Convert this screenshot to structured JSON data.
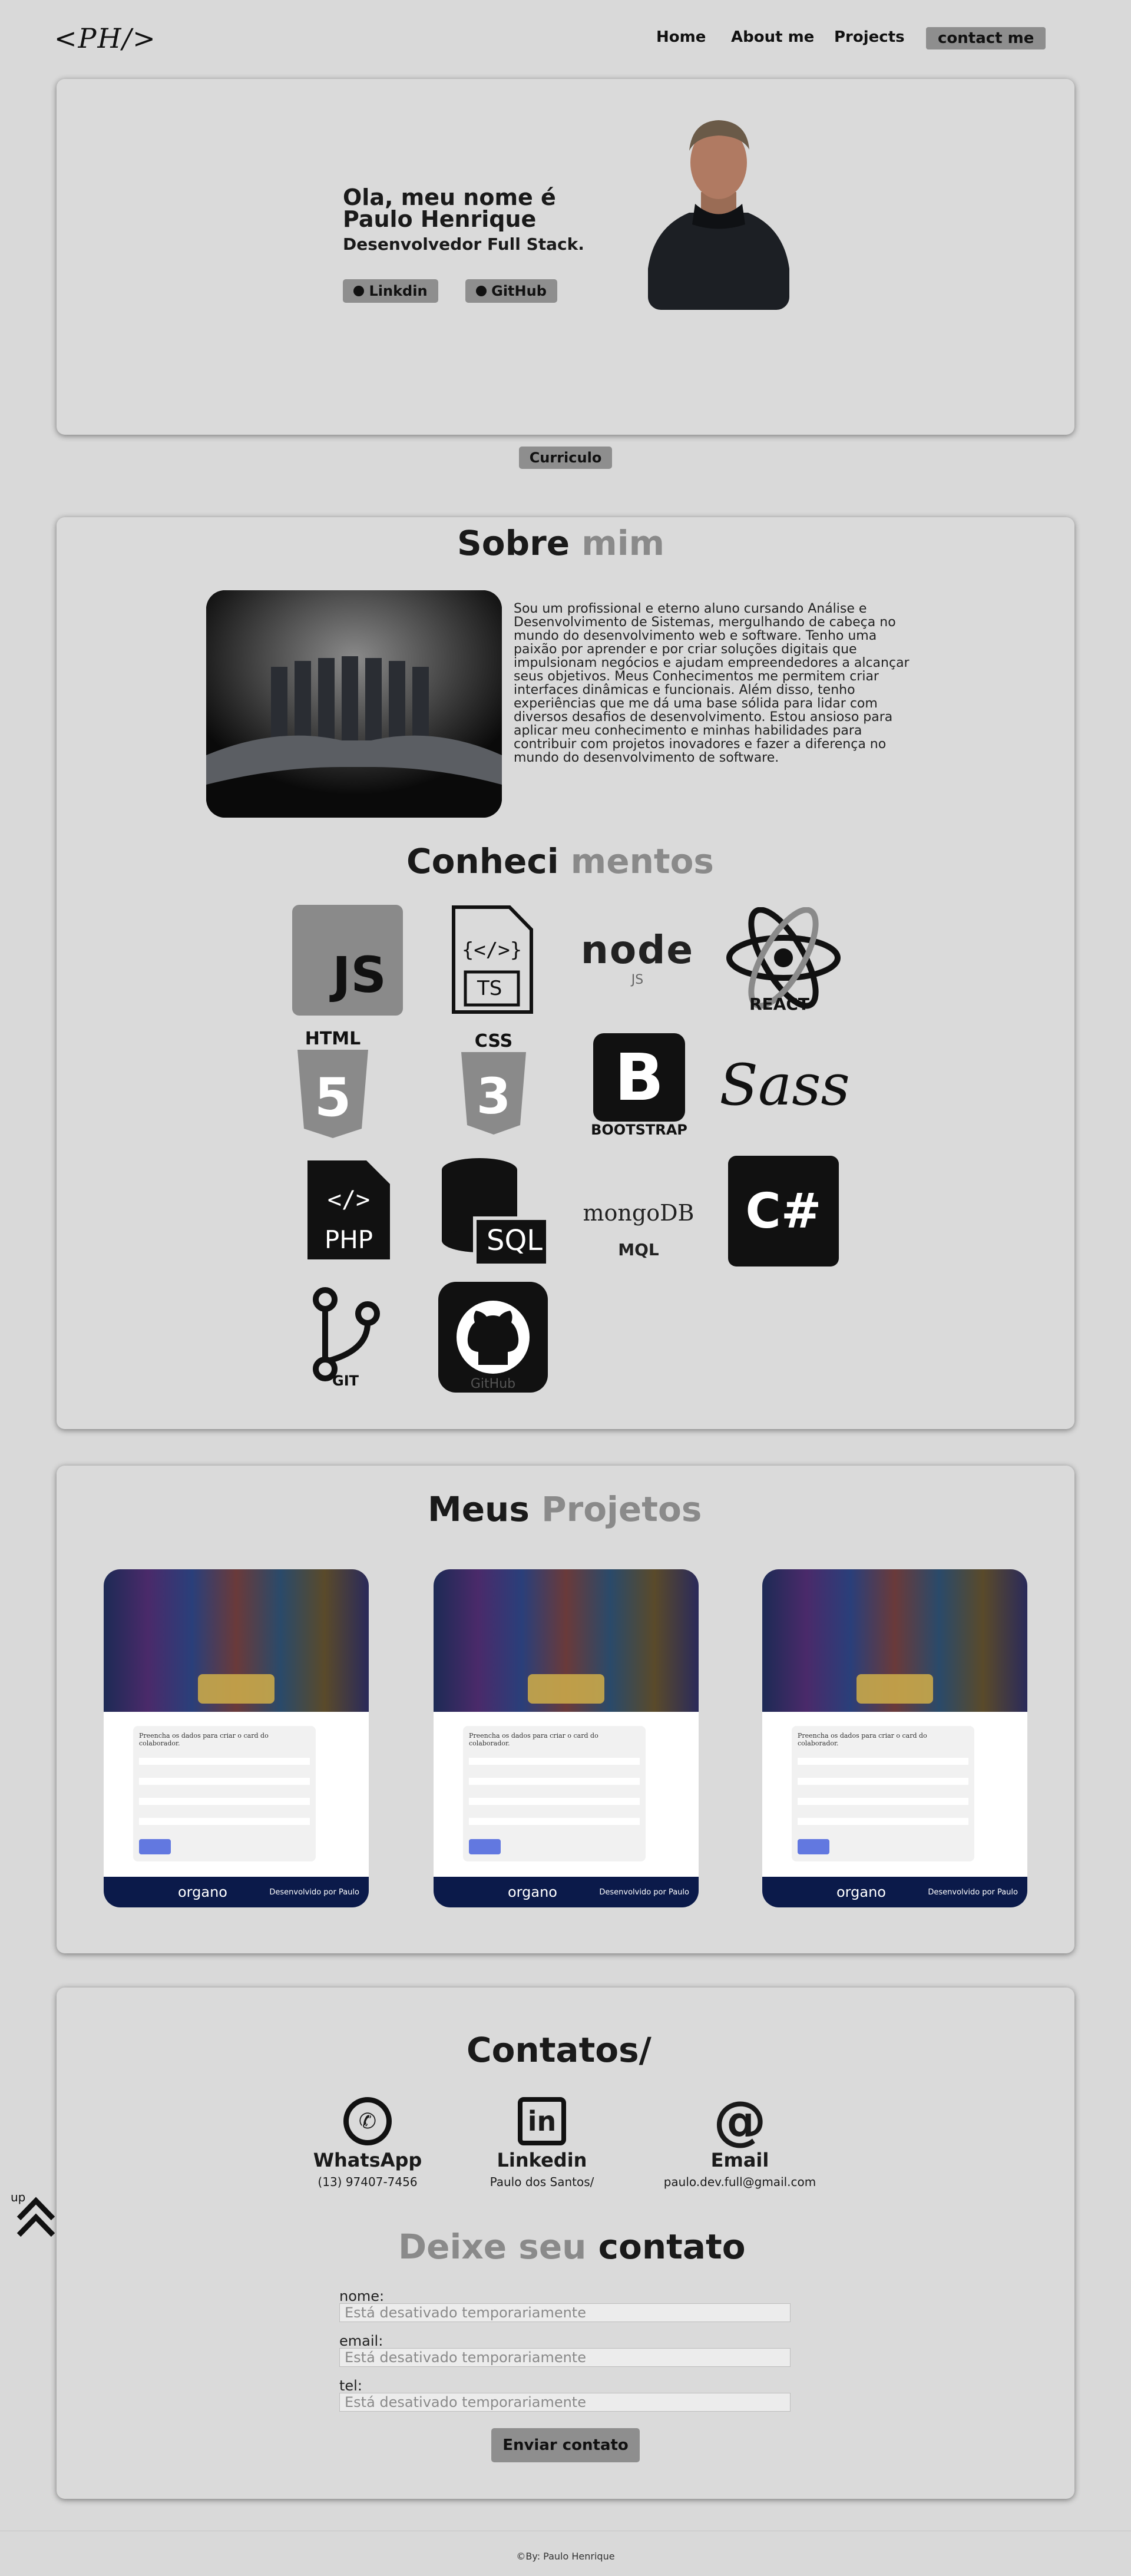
{
  "header": {
    "logo": "<PH/>",
    "nav": [
      "Home",
      "About me",
      "Projects",
      "contact me"
    ]
  },
  "hero": {
    "greeting": "Ola, meu nome é",
    "name": "Paulo Henrique",
    "role": "Desenvolvedor Full Stack.",
    "linkedin_btn": "Linkdin",
    "github_btn": "GitHub",
    "curriculo_btn": "Curriculo"
  },
  "about": {
    "title_a": "Sobre",
    "title_b": "mim",
    "text": "Sou um profissional e eterno aluno cursando Análise e Desenvolvimento de Sistemas, mergulhando de cabeça no mundo do desenvolvimento web e software. Tenho uma paixão por aprender e por criar soluções digitais que impulsionam negócios e ajudam empreendedores a alcançar seus objetivos. Meus Conhecimentos me permitem criar interfaces dinâmicas e funcionais. Além disso, tenho experiências que me dá uma base sólida para lidar com diversos desafios de desenvolvimento. Estou ansioso para aplicar meu conhecimento e minhas habilidades para contribuir com projetos inovadores e fazer a diferença no mundo do desenvolvimento de software."
  },
  "skills": {
    "title_a": "Conheci",
    "title_b": "mentos",
    "icons": [
      {
        "name": "javascript-icon",
        "text": "JS"
      },
      {
        "name": "typescript-icon",
        "text": "TS"
      },
      {
        "name": "nodejs-icon",
        "text": "node"
      },
      {
        "name": "react-icon",
        "text": "REACT"
      },
      {
        "name": "html5-icon",
        "text": "HTML"
      },
      {
        "name": "css3-icon",
        "text": "CSS"
      },
      {
        "name": "bootstrap-icon",
        "text": "BOOTSTRAP"
      },
      {
        "name": "sass-icon",
        "text": "Sass"
      },
      {
        "name": "php-icon",
        "text": "PHP"
      },
      {
        "name": "sql-icon",
        "text": "SQL"
      },
      {
        "name": "mongodb-icon",
        "text": "mongoDB",
        "sub": "MQL"
      },
      {
        "name": "csharp-icon",
        "text": "C#"
      },
      {
        "name": "git-icon",
        "text": "GIT"
      },
      {
        "name": "github-icon",
        "text": "GitHub"
      }
    ]
  },
  "projects": {
    "title_a": "Meus",
    "title_b": "Projetos",
    "items": [
      {
        "form_title": "Preencha os dados para criar o card do colaborador.",
        "footer_brand": "organo",
        "footer_credit": "Desenvolvido por Paulo"
      },
      {
        "form_title": "Preencha os dados para criar o card do colaborador.",
        "footer_brand": "organo",
        "footer_credit": "Desenvolvido por Paulo"
      },
      {
        "form_title": "Preencha os dados para criar o card do colaborador.",
        "footer_brand": "organo",
        "footer_credit": "Desenvolvido por Paulo"
      }
    ]
  },
  "contacts": {
    "title": "Contatos/",
    "items": [
      {
        "label": "WhatsApp",
        "sub": "(13) 97407-7456"
      },
      {
        "label": "Linkedin",
        "sub": "Paulo dos Santos/"
      },
      {
        "label": "Email",
        "sub": "paulo.dev.full@gmail.com"
      }
    ],
    "form_title_a": "Deixe seu",
    "form_title_b": "contato",
    "fields": [
      {
        "label": "nome:",
        "value": "Está desativado temporariamente"
      },
      {
        "label": "email:",
        "value": "Está desativado temporariamente"
      },
      {
        "label": "tel:",
        "value": "Está desativado temporariamente"
      }
    ],
    "submit": "Enviar contato"
  },
  "up": {
    "label": "up"
  },
  "footer": {
    "text": "©By: Paulo Henrique"
  },
  "colors": {
    "background": "#d9d9d9",
    "button": "#8e8e8e",
    "accent_grey": "#8a8a8a"
  }
}
